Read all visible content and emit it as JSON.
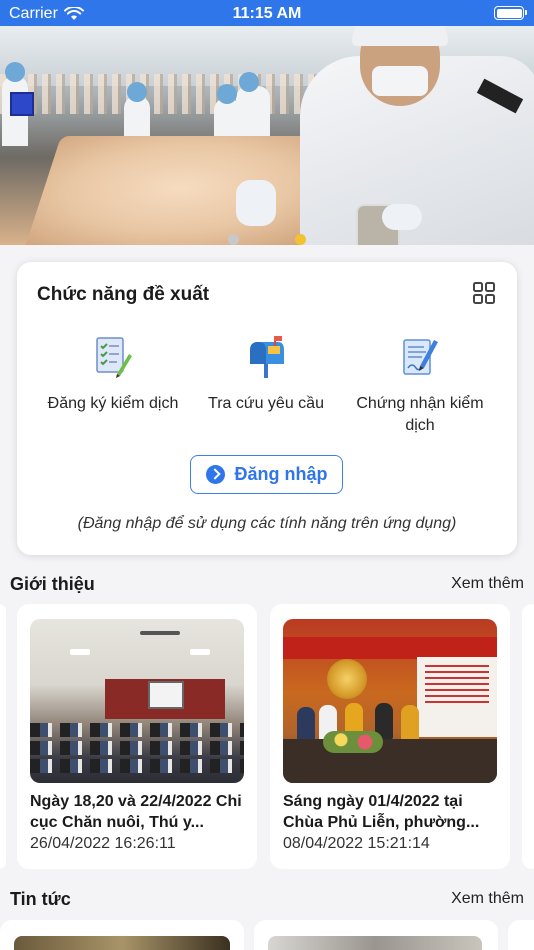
{
  "status_bar": {
    "carrier": "Carrier",
    "time": "11:15 AM"
  },
  "banner": {
    "description_icon": "food-inspection-photo",
    "carousel_total": 2,
    "carousel_active": 2,
    "active_dot_color": "#f2c230",
    "inactive_dot_color": "#c8c8c8"
  },
  "suggested": {
    "title": "Chức năng đề xuất",
    "items": [
      {
        "label": "Đăng ký kiểm dịch",
        "icon": "checklist-document-icon"
      },
      {
        "label": "Tra cứu yêu cầu",
        "icon": "mailbox-icon"
      },
      {
        "label": "Chứng nhận kiểm dịch",
        "icon": "signed-document-icon"
      }
    ],
    "login_label": "Đăng nhập",
    "hint": "(Đăng nhập để sử dụng các tính năng trên ứng dụng)"
  },
  "intro": {
    "title": "Giới thiệu",
    "more": "Xem thêm",
    "articles": [
      {
        "headline": "Ngày 18,20 và 22/4/2022 Chi cục Chăn nuôi, Thú y...",
        "date": "26/04/2022 16:26:11"
      },
      {
        "headline": "Sáng ngày 01/4/2022 tại Chùa Phủ Liễn, phường...",
        "date": "08/04/2022 15:21:14"
      }
    ]
  },
  "news": {
    "title": "Tin tức",
    "more": "Xem thêm"
  },
  "colors": {
    "primary": "#2f76ea"
  }
}
